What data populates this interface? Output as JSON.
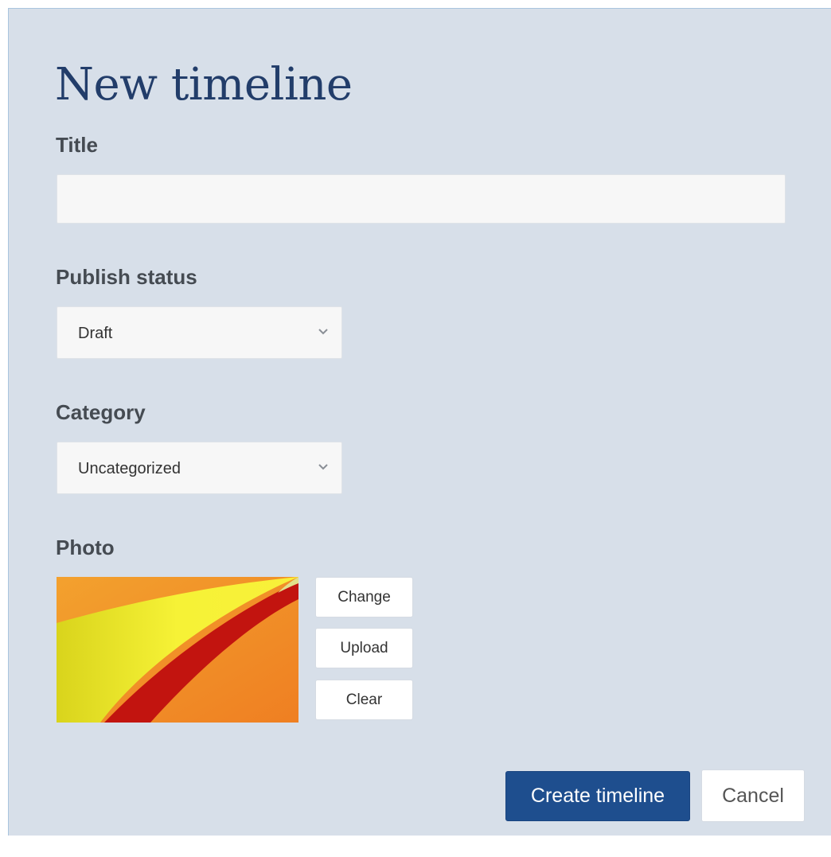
{
  "form": {
    "heading": "New timeline",
    "title_label": "Title",
    "title_value": "",
    "title_placeholder": "",
    "publish_status_label": "Publish status",
    "publish_status_value": "Draft",
    "category_label": "Category",
    "category_value": "Uncategorized",
    "photo_label": "Photo",
    "photo_buttons": {
      "change": "Change",
      "upload": "Upload",
      "clear": "Clear"
    },
    "submit_label": "Create timeline",
    "cancel_label": "Cancel"
  },
  "icons": {
    "dropdown": "chevron-down-icon"
  },
  "colors": {
    "panel_background": "#d7dfe9",
    "heading": "#223d6a",
    "primary_button": "#1e4e8e"
  }
}
